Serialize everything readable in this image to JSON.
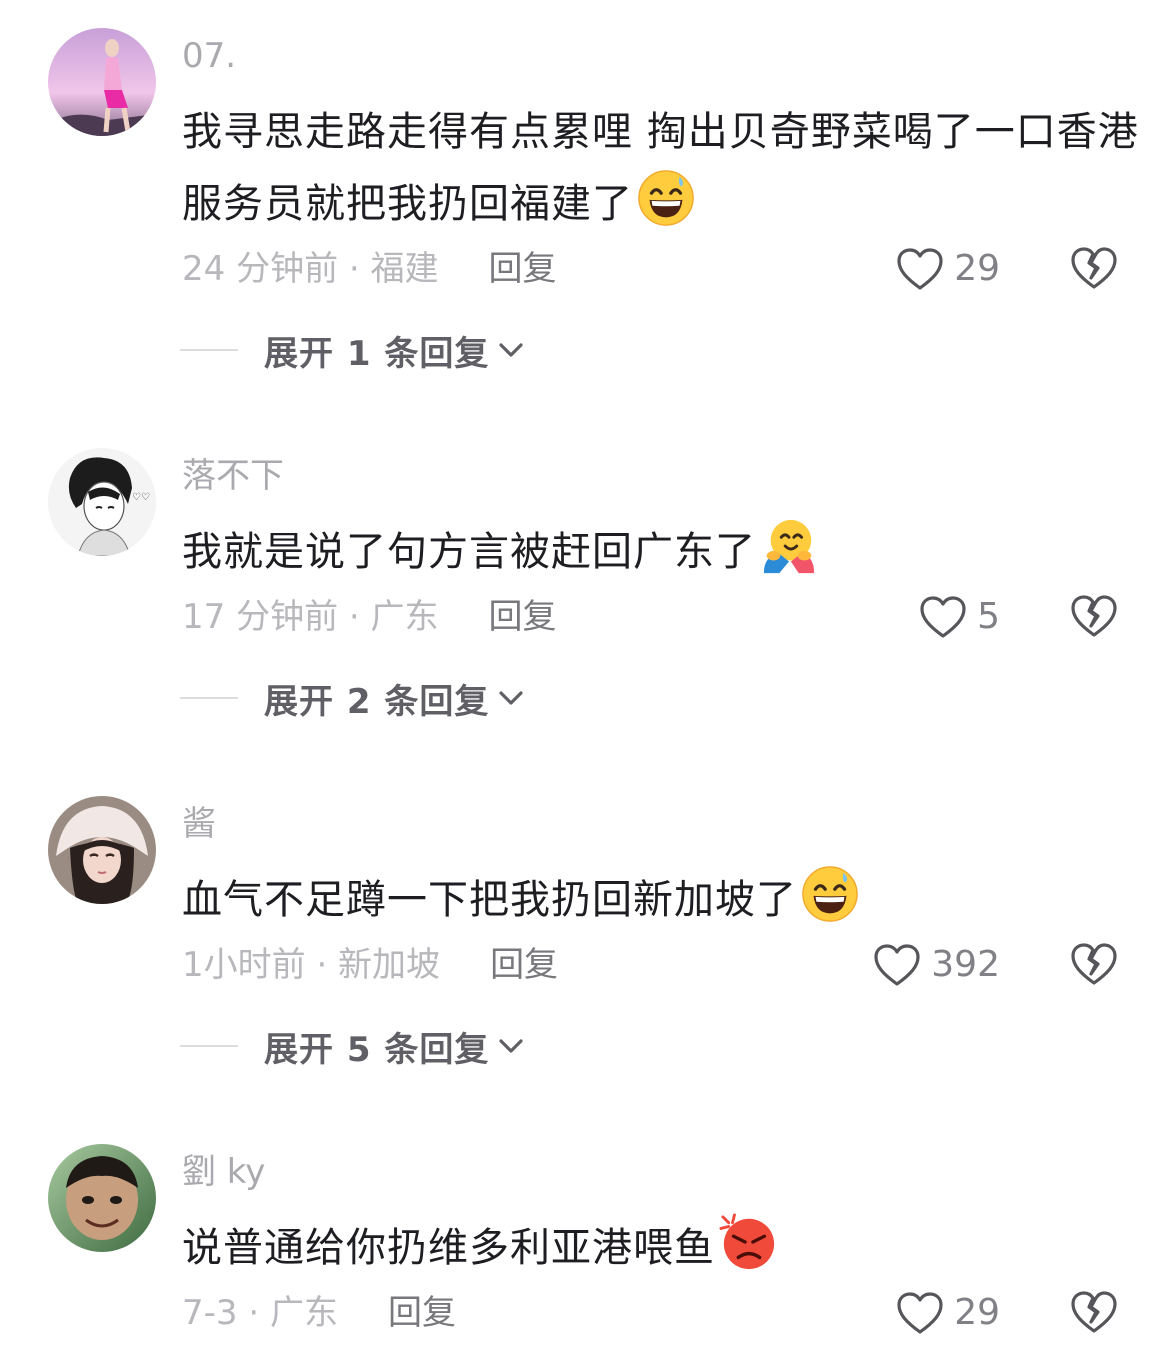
{
  "comments": [
    {
      "username": "07.",
      "text": "我寻思走路走得有点累哩 掏出贝奇野菜喝了一口香港服务员就把我扔回福建了",
      "emoji": "grinning-sweat-emoji",
      "time_location": "24 分钟前 · 福建",
      "reply": "回复",
      "likes": "29",
      "expand": "展开 1 条回复"
    },
    {
      "username": "落不下",
      "text": "我就是说了句方言被赶回广东了",
      "emoji": "hugging-face-emoji",
      "time_location": "17 分钟前 · 广东",
      "reply": "回复",
      "likes": "5",
      "expand": "展开 2 条回复"
    },
    {
      "username": "酱",
      "text": "血气不足蹲一下把我扔回新加坡了",
      "emoji": "grinning-sweat-emoji",
      "time_location": "1小时前 · 新加坡",
      "reply": "回复",
      "likes": "392",
      "expand": "展开 5 条回复"
    },
    {
      "username": "劉 ky",
      "text": "说普通给你扔维多利亚港喂鱼",
      "emoji": "angry-face-emoji",
      "time_location": "7-3 · 广东",
      "reply": "回复",
      "likes": "29"
    }
  ],
  "icons": {
    "like": "heart-outline-icon",
    "dislike": "broken-heart-icon",
    "expand": "chevron-down-icon"
  },
  "colors": {
    "text": "#1d1d22",
    "username": "#a9a9ae",
    "meta": "#b7b7bc",
    "icon": "#55555a"
  }
}
